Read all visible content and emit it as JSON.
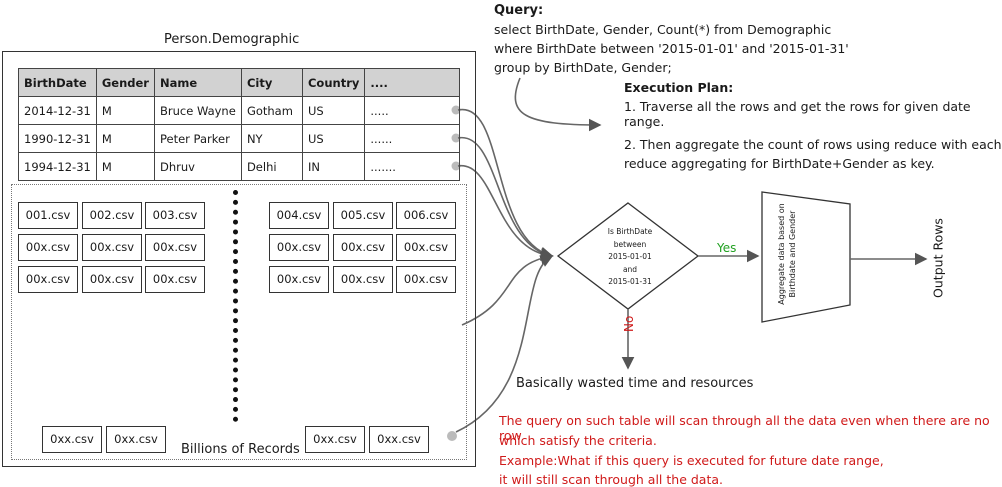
{
  "table": {
    "title": "Person.Demographic",
    "headers": [
      "BirthDate",
      "Gender",
      "Name",
      "City",
      "Country",
      "...."
    ],
    "rows": [
      [
        "2014-12-31",
        "M",
        "Bruce Wayne",
        "Gotham",
        "US",
        "....."
      ],
      [
        "1990-12-31",
        "M",
        "Peter Parker",
        "NY",
        "US",
        "......"
      ],
      [
        "1994-12-31",
        "M",
        "Dhruv",
        "Delhi",
        "IN",
        "......."
      ]
    ]
  },
  "files": {
    "left_grid": [
      [
        "001.csv",
        "002.csv",
        "003.csv"
      ],
      [
        "00x.csv",
        "00x.csv",
        "00x.csv"
      ],
      [
        "00x.csv",
        "00x.csv",
        "00x.csv"
      ]
    ],
    "right_grid": [
      [
        "004.csv",
        "005.csv",
        "006.csv"
      ],
      [
        "00x.csv",
        "00x.csv",
        "00x.csv"
      ],
      [
        "00x.csv",
        "00x.csv",
        "00x.csv"
      ]
    ],
    "bottom_left": [
      "0xx.csv",
      "0xx.csv"
    ],
    "bottom_right": [
      "0xx.csv",
      "0xx.csv"
    ],
    "caption": "Billions of Records"
  },
  "query": {
    "title": "Query:",
    "lines": [
      "select BirthDate, Gender, Count(*) from Demographic",
      "where BirthDate between '2015-01-01' and '2015-01-31'",
      "group by BirthDate, Gender;"
    ]
  },
  "plan": {
    "title": "Execution Plan:",
    "lines": [
      "1. Traverse all the rows and get the rows for given date range.",
      "",
      "2. Then aggregate the count of rows using reduce with each",
      "reduce  aggregating for BirthDate+Gender as key."
    ]
  },
  "flow": {
    "decision_lines": [
      "Is BirthDate",
      "between",
      "2015-01-01",
      "and",
      "2015-01-31"
    ],
    "yes_label": "Yes",
    "no_label": "No",
    "aggregate_lines": [
      "Aggregate data based on",
      "Birthdate and Gender"
    ],
    "output_label": "Output Rows",
    "wasted_label": "Basically wasted time and resources"
  },
  "note": {
    "lines": [
      "The query on such table will scan through all the data even when there are no row",
      "which satisfy the criteria.",
      " Example:What if this query is executed for future date range,",
      "it will still scan through all the data."
    ]
  },
  "colors": {
    "yes": "#21a121",
    "no": "#d01a1a",
    "note": "#d01a1a",
    "header_bg": "#d2d2d2",
    "connector": "#666666"
  }
}
